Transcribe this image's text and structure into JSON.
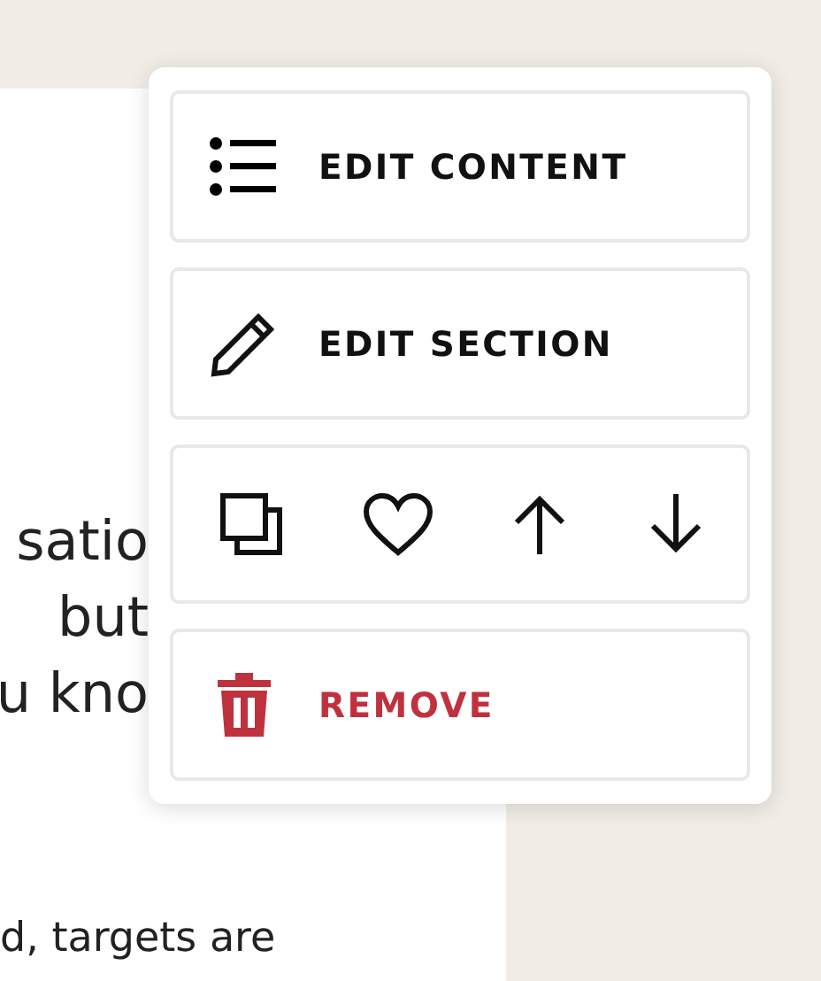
{
  "article": {
    "lines": [
      "satio",
      "but",
      "u kno"
    ],
    "footer_line": "d, targets are"
  },
  "menu": {
    "items": [
      {
        "kind": "content",
        "label": "EDIT CONTENT"
      },
      {
        "kind": "section",
        "label": "EDIT SECTION"
      },
      {
        "kind": "tools"
      },
      {
        "kind": "remove",
        "label": "REMOVE"
      }
    ]
  }
}
